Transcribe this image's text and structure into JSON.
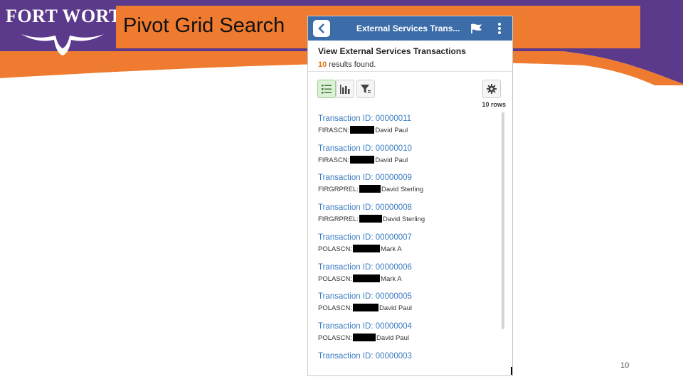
{
  "slide": {
    "logo_text": "FORT WORTH",
    "title": "Pivot Grid Search",
    "page_number": "10"
  },
  "app": {
    "nav_title": "External Services Trans...",
    "page_title": "View External Services Transactions",
    "results_count": "10",
    "results_suffix": " results found.",
    "row_count_label": "10 rows",
    "colors": {
      "header_bar": "#3c6da9",
      "link": "#3a7cc2",
      "count": "#e07a12"
    },
    "icons": [
      "back-icon",
      "flag-icon",
      "more-options-icon",
      "list-view-icon",
      "chart-view-icon",
      "filter-icon",
      "gear-icon"
    ]
  },
  "transactions": [
    {
      "id": "Transaction ID: 00000011",
      "code": "FIRASCN:",
      "name": "David Paul"
    },
    {
      "id": "Transaction ID: 00000010",
      "code": "FIRASCN:",
      "name": "David Paul"
    },
    {
      "id": "Transaction ID: 00000009",
      "code": "FIRGRPREL:",
      "name": "David Sterling"
    },
    {
      "id": "Transaction ID: 00000008",
      "code": "FIRGRPREL:",
      "name": "David Sterling"
    },
    {
      "id": "Transaction ID: 00000007",
      "code": "POLASCN:",
      "name": "Mark A"
    },
    {
      "id": "Transaction ID: 00000006",
      "code": "POLASCN:",
      "name": "Mark A"
    },
    {
      "id": "Transaction ID: 00000005",
      "code": "POLASCN:",
      "name": "David Paul"
    },
    {
      "id": "Transaction ID: 00000004",
      "code": "POLASCN:",
      "name": "David Paul"
    },
    {
      "id": "Transaction ID: 00000003",
      "code": "",
      "name": ""
    }
  ]
}
